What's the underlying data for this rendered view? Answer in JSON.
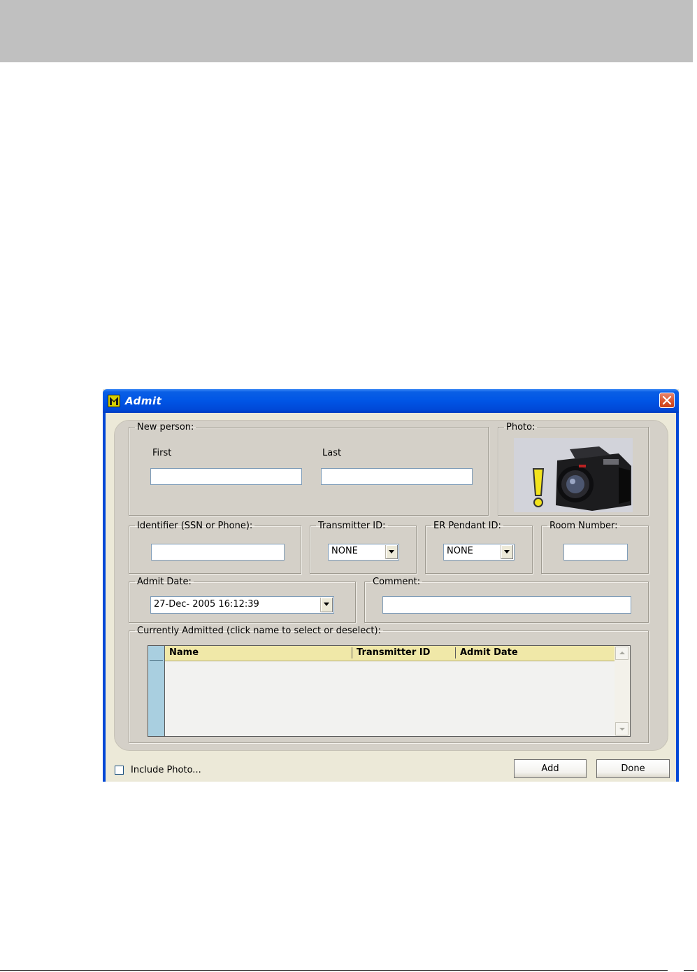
{
  "window": {
    "title": "Admit"
  },
  "new_person": {
    "legend": "New person:",
    "first_label": "First",
    "last_label": "Last",
    "first_value": "",
    "last_value": ""
  },
  "photo": {
    "legend": "Photo:"
  },
  "identifier": {
    "legend": "Identifier (SSN or Phone):",
    "value": ""
  },
  "transmitter": {
    "legend": "Transmitter ID:",
    "selected": "NONE"
  },
  "er_pendant": {
    "legend": "ER Pendant ID:",
    "selected": "NONE"
  },
  "room": {
    "legend": "Room Number:",
    "value": ""
  },
  "admit_date": {
    "legend": "Admit Date:",
    "value": "27-Dec- 2005  16:12:39"
  },
  "comment": {
    "legend": "Comment:",
    "value": ""
  },
  "currently_admitted": {
    "legend": "Currently Admitted (click name to select or deselect):",
    "columns": [
      "Name",
      "Transmitter ID",
      "Admit Date"
    ],
    "rows": []
  },
  "footer": {
    "include_photo_label": "Include Photo...",
    "include_photo_checked": false,
    "add_label": "Add",
    "done_label": "Done"
  },
  "colors": {
    "titlebar": "#0055e5",
    "grid_header": "#f0e8a8",
    "row_header": "#a9cfe0",
    "panel": "#d4d0c8"
  }
}
